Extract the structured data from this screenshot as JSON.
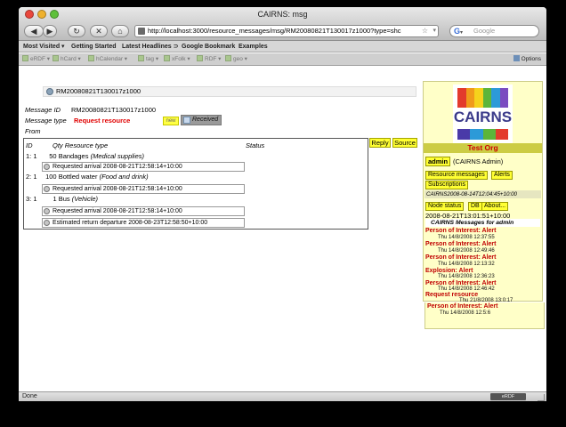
{
  "window": {
    "title": "CAIRNS: msg"
  },
  "toolbar": {
    "back_glyph": "◀",
    "forward_glyph": "▶",
    "reload_glyph": "↻",
    "stop_glyph": "✕",
    "home_glyph": "⌂",
    "url": "http://localhost:3000/resource_messages/msg/RM20080821T130017z1000?type=shc",
    "search_placeholder": "Google"
  },
  "bookmarks": [
    "Most Visited ▾",
    "Getting Started",
    "Latest Headlines ⊃",
    "Google Bookmark",
    "Examples"
  ],
  "extensions": {
    "items": [
      "eRDF ▾",
      "hCard ▾",
      "hCalendar ▾",
      "tag ▾",
      "xFolk ▾",
      "RDF ▾",
      "geo ▾"
    ],
    "options_label": "Options"
  },
  "message": {
    "header_id": "RM20080821T130017z1000",
    "id_label": "Message ID",
    "id_value": "RM20080821T130017z1000",
    "type_label": "Message type",
    "type_value": "Request resource",
    "tag_new": "new",
    "received_label": "Received",
    "from_label": "From",
    "reply_label": "Reply",
    "source_label": "Source"
  },
  "table": {
    "headers": {
      "id": "ID",
      "qty_type": "Qty Resource type",
      "status": "Status"
    },
    "rows": [
      {
        "id_qty": "1: 1",
        "qty": "50",
        "name": "Bandages",
        "category": "(Medical supplies)",
        "details": [
          "Requested arrival 2008-08-21T12:58:14+10:00"
        ]
      },
      {
        "id_qty": "2: 1",
        "qty": "100",
        "name": "Bottled water",
        "category": "(Food and drink)",
        "details": [
          "Requested arrival 2008-08-21T12:58:14+10:00"
        ]
      },
      {
        "id_qty": "3: 1",
        "qty": "1",
        "name": "Bus",
        "category": "(Vehicle)",
        "details": [
          "Requested arrival 2008-08-21T12:58:14+10:00",
          "Estimated return departure 2008-08-23T12:58:50+10:00"
        ]
      }
    ]
  },
  "sidebar": {
    "logo_text": "CAIRNS",
    "org_name": "Test Org",
    "user_badge": "admin",
    "user_name": "(CAIRNS Admin)",
    "btn_resource_messages": "Resource messages",
    "btn_alerts": "Alerts",
    "btn_subscriptions": "Subscriptions",
    "recent_message": "CAIRNS2008-08-14T12:04:45+10:00",
    "btn_node_status": "Node status",
    "btn_db": "DB",
    "btn_about": "About...",
    "timestamp": "2008-08-21T13:01:51+10:00",
    "messages_header": "CAIRNS Messages for admin",
    "messages": [
      {
        "title": "Person of Interest: Alert",
        "date": "Thu 14/8/2008 12:37:55"
      },
      {
        "title": "Person of Interest: Alert",
        "date": "Thu 14/8/2008 12:49:46"
      },
      {
        "title": "Person of Interest: Alert",
        "date": "Thu 14/8/2008 12:13:32"
      },
      {
        "title": "Explosion: Alert",
        "date": "Thu 14/8/2008 12:36:23"
      },
      {
        "title": "Person of Interest: Alert",
        "date": "Thu 14/8/2008 12:46:42"
      },
      {
        "title": "Request resource",
        "date": "Thu 21/8/2008 13:0:17"
      },
      {
        "title": "Person of Interest: Alert",
        "date": "Thu 14/8/2008 12:5:6"
      }
    ]
  },
  "status": {
    "text": "Done",
    "extension_label": "eRDF"
  }
}
